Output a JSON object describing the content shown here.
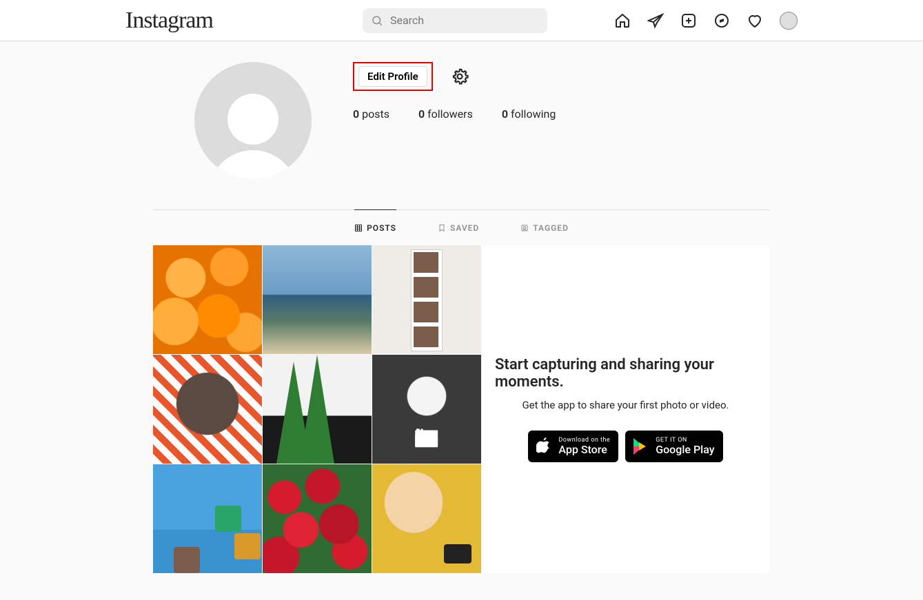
{
  "nav": {
    "logo": "Instagram",
    "search_placeholder": "Search"
  },
  "profile": {
    "edit_label": "Edit Profile",
    "stats": {
      "posts_count": "0",
      "posts_label": "posts",
      "followers_count": "0",
      "followers_label": "followers",
      "following_count": "0",
      "following_label": "following"
    }
  },
  "tabs": {
    "posts": "POSTS",
    "saved": "SAVED",
    "tagged": "TAGGED"
  },
  "promo": {
    "heading": "Start capturing and sharing your moments.",
    "sub": "Get the app to share your first photo or video.",
    "appstore_small": "Download on the",
    "appstore_big": "App Store",
    "gplay_small": "GET IT ON",
    "gplay_big": "Google Play"
  },
  "highlight": {
    "target": "edit-profile-button",
    "color": "#e60000"
  }
}
